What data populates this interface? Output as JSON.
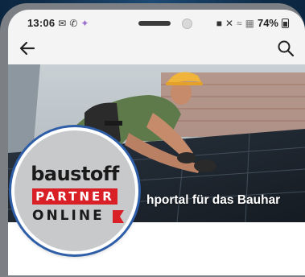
{
  "status_bar": {
    "time": "13:06",
    "battery": "74%",
    "icons_left": [
      "mail-icon",
      "whatsapp-icon",
      "notification-icon"
    ],
    "icons_right": [
      "mute-icon",
      "bluetooth-off-icon",
      "wifi-icon",
      "signal-icon",
      "battery-icon"
    ]
  },
  "app_bar": {
    "back_icon": "arrow-left-icon",
    "search_icon": "search-icon"
  },
  "hero": {
    "caption": "hportal für das Bauhar",
    "image": "worker installing solar panels on roof"
  },
  "logo": {
    "word_top": "baustoff",
    "word_middle": "PARTNER",
    "word_bottom": "ONLINE"
  },
  "colors": {
    "brand_red": "#d92027",
    "logo_ring": "#2e5ea8",
    "backdrop": "#0d2a46"
  }
}
